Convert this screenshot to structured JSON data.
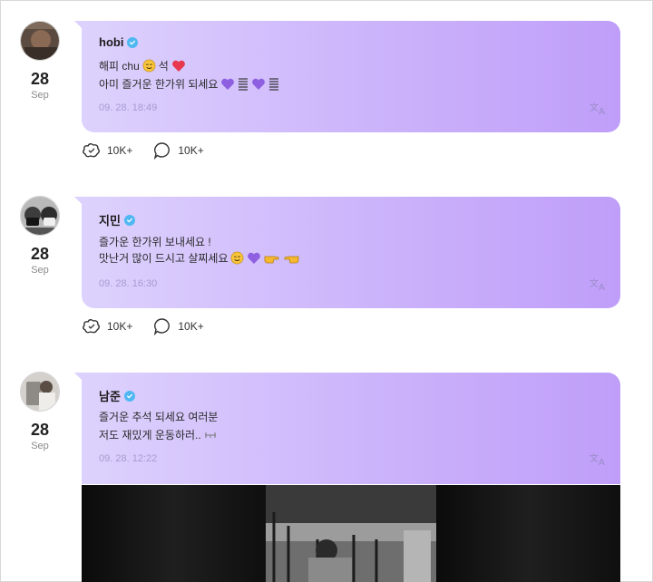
{
  "posts": [
    {
      "author": "hobi",
      "lines": [
        "해피 chu",
        "석",
        "아미 즐거운 한가위 되세요"
      ],
      "time": "09. 28. 18:49",
      "day": "28",
      "month": "Sep",
      "reactions": "10K+",
      "comments": "10K+"
    },
    {
      "author": "지민",
      "lines": [
        "즐가운 한가위 보내세요 !",
        "맛난거 많이 드시고 살찌세요"
      ],
      "time": "09. 28. 16:30",
      "day": "28",
      "month": "Sep",
      "reactions": "10K+",
      "comments": "10K+"
    },
    {
      "author": "남준",
      "lines": [
        "즐거운 추석 되세요 여러분",
        "저도 재밌게 운동하러.."
      ],
      "time": "09. 28. 12:22",
      "day": "28",
      "month": "Sep"
    }
  ],
  "colors": {
    "bubble_start": "#ddd2fd",
    "bubble_end": "#bf9ef9",
    "verified": "#4fb8f2",
    "purple_heart": "#8e5fe0",
    "red_heart": "#e8384f"
  },
  "icons": {
    "verified": "verified-badge-icon",
    "translate": "translate-icon",
    "reaction": "reaction-icon",
    "comment": "comment-icon"
  }
}
